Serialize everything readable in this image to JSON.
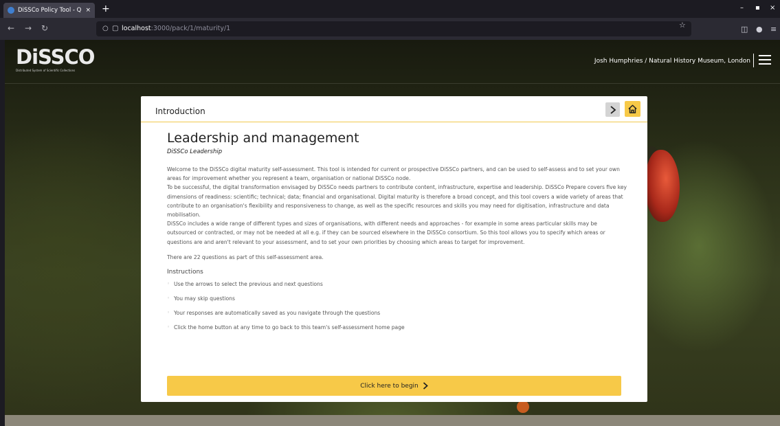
{
  "browser": {
    "tab_title": "DiSSCo Policy Tool - Que",
    "tab_close": "×",
    "new_tab": "+",
    "url_host": "localhost",
    "url_path": ":3000/pack/1/maturity/1",
    "minimize": "–",
    "maximize": "▪",
    "close": "×"
  },
  "header": {
    "logo_text": "DiSSCO",
    "logo_sub": "Distributed System of Scientific Collections",
    "user_info": "Josh Humphries / Natural History Museum, London"
  },
  "card": {
    "section_title": "Introduction",
    "title": "Leadership and management",
    "subtitle": "DiSSCo Leadership",
    "intro_paragraphs": [
      "Welcome to the DiSSCo digital maturity self-assessment. This tool is intended for current or prospective DiSSCo partners, and can be used to self-assess and to set your own areas for improvement whether you represent a team, organisation or national DiSSCo node.",
      "To be successful, the digital transformation envisaged by DiSSCo needs partners to contribute content, infrastructure, expertise and leadership. DiSSCo Prepare covers five key dimensions of readiness: scientific; technical; data; financial and organisational. Digital maturity is therefore a broad concept, and this tool covers a wide variety of areas that contribute to an organisation's flexibility and responsiveness to change, as well as the specific resources and skills you may need for digitisation, infrastructure and data mobilisation.",
      "DiSSCo includes a wide range of different types and sizes of organisations, with different needs and approaches - for example in some areas particular skills may be outsourced or contracted, or may not be needed at all e.g. if they can be sourced elsewhere in the DiSSCo consortium. So this tool allows you to specify which areas or questions are and aren't relevant to your assessment, and to set your own priorities by choosing which areas to target for improvement."
    ],
    "question_count_text": "There are 22 questions as part of this self-assessment area.",
    "instructions_title": "Instructions",
    "instructions": [
      "Use the arrows to select the previous and next questions",
      "You may skip questions",
      "Your responses are automatically saved as you navigate through the questions",
      "Click the home button at any time to go back to this team's self-assessment home page"
    ],
    "begin_label": "Click here to begin"
  },
  "icons": {
    "next": "chevron-right-icon",
    "home": "home-icon",
    "menu": "hamburger-menu-icon"
  },
  "colors": {
    "accent": "#f7c948",
    "card_bg": "#ffffff",
    "chrome_bg": "#1c1b22"
  }
}
